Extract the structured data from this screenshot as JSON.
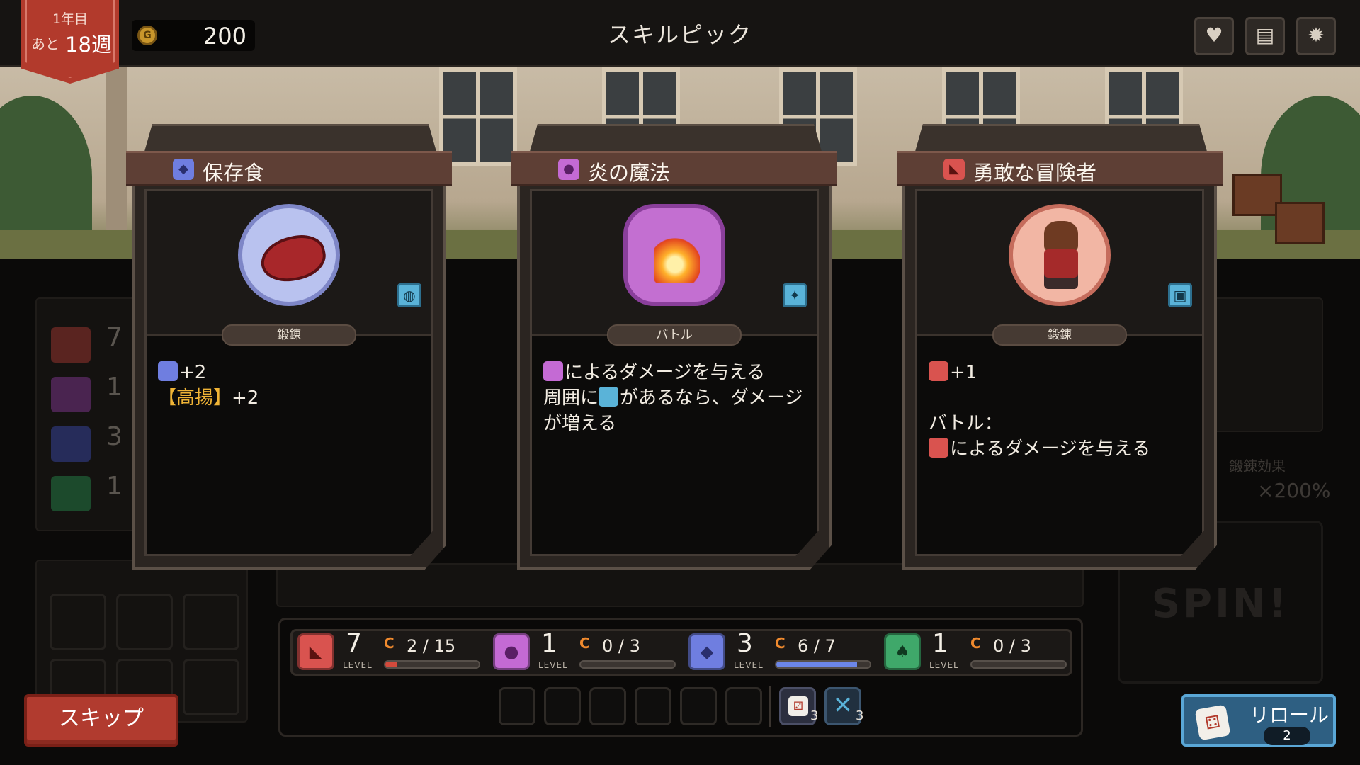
{
  "header": {
    "year": "1年目",
    "weeks_prefix": "あと",
    "weeks_left": "18週",
    "gold": "200",
    "title": "スキルピック",
    "icons": [
      "heart-icon",
      "briefcase-icon",
      "gear-icon"
    ]
  },
  "cards": [
    {
      "title": "保存食",
      "category": "鍛錬",
      "header_icon": "body-icon",
      "emblem": "meat-icon",
      "badge_icon": "bag-icon",
      "lines": [
        {
          "prefix_icon": "body-p-icon",
          "text": "+2"
        },
        {
          "highlight": "【高揚】",
          "text": "+2"
        }
      ]
    },
    {
      "title": "炎の魔法",
      "category": "バトル",
      "header_icon": "mind-icon",
      "emblem": "fire-icon",
      "badge_icon": "sparkle-icon",
      "lines": [
        {
          "prefix_icon": "mind-lv-icon",
          "text": "によるダメージを与える"
        },
        {
          "text": "周囲に",
          "inline_icon": "wand-icon",
          "text_after": "があるなら、ダメージ"
        },
        {
          "text": "が増える"
        }
      ]
    },
    {
      "title": "勇敢な冒険者",
      "category": "鍛錬",
      "header_icon": "strength-icon",
      "emblem": "hero-portrait",
      "badge_icon": "person-icon",
      "lines": [
        {
          "prefix_icon": "strength-p-icon",
          "text": "+1"
        },
        {
          "text": ""
        },
        {
          "text": "バトル："
        },
        {
          "prefix_icon": "strength-lv-icon",
          "text": "によるダメージを与える"
        }
      ]
    }
  ],
  "stats": [
    {
      "name": "strength",
      "icon": "arm-icon",
      "level": "7",
      "level_label": "LEVEL",
      "c": "C",
      "current": "2",
      "max": "15",
      "progress": 0.13,
      "color": "#d9534f",
      "fill": "#d34a3c"
    },
    {
      "name": "mind",
      "icon": "brain-icon",
      "level": "1",
      "level_label": "LEVEL",
      "c": "C",
      "current": "0",
      "max": "3",
      "progress": 0.0,
      "color": "#c46ad4",
      "fill": "#b85ac8"
    },
    {
      "name": "body",
      "icon": "torso-icon",
      "level": "3",
      "level_label": "LEVEL",
      "c": "C",
      "current": "6",
      "max": "7",
      "progress": 0.86,
      "color": "#6f7ee0",
      "fill": "#6c86e8"
    },
    {
      "name": "agility",
      "icon": "lungs-icon",
      "level": "1",
      "level_label": "LEVEL",
      "c": "C",
      "current": "0",
      "max": "3",
      "progress": 0.0,
      "color": "#3fa86a",
      "fill": "#3fa86a"
    }
  ],
  "dice": [
    {
      "icon": "dice-icon",
      "count": "3"
    },
    {
      "icon": "cross-icon",
      "count": "3"
    }
  ],
  "buttons": {
    "skip": "スキップ",
    "reroll": "リロール",
    "reroll_count": "2"
  },
  "background": {
    "spin_label": "SPIN!",
    "effect_label": "鍛錬効果",
    "effect_value": "×200%"
  }
}
